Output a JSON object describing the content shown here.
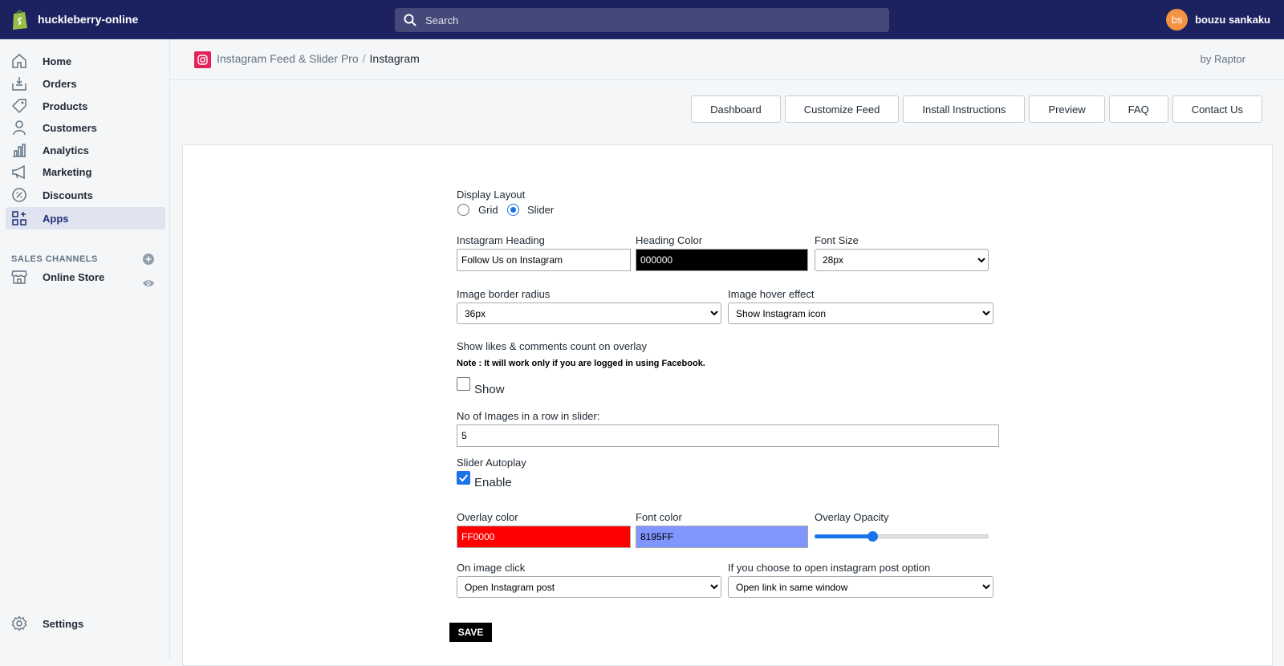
{
  "topbar": {
    "store_name": "huckleberry-online",
    "search_placeholder": "Search",
    "user_initials": "bs",
    "user_name": "bouzu sankaku"
  },
  "sidebar": {
    "items": [
      {
        "label": "Home",
        "icon": "home-icon"
      },
      {
        "label": "Orders",
        "icon": "orders-icon"
      },
      {
        "label": "Products",
        "icon": "tag-icon"
      },
      {
        "label": "Customers",
        "icon": "person-icon"
      },
      {
        "label": "Analytics",
        "icon": "bar-chart-icon"
      },
      {
        "label": "Marketing",
        "icon": "megaphone-icon"
      },
      {
        "label": "Discounts",
        "icon": "discount-icon"
      },
      {
        "label": "Apps",
        "icon": "apps-icon"
      }
    ],
    "sales_channels_title": "SALES CHANNELS",
    "online_store": "Online Store",
    "settings": "Settings"
  },
  "header": {
    "app_name": "Instagram Feed & Slider Pro",
    "separator": "/",
    "current": "Instagram",
    "byline": "by Raptor"
  },
  "tabs": [
    "Dashboard",
    "Customize Feed",
    "Install Instructions",
    "Preview",
    "FAQ",
    "Contact Us"
  ],
  "form": {
    "display_layout_label": "Display Layout",
    "layout_grid": "Grid",
    "layout_slider": "Slider",
    "layout_selected": "Slider",
    "heading_label": "Instagram Heading",
    "heading_value": "Follow Us on Instagram",
    "heading_color_label": "Heading Color",
    "heading_color_value": "000000",
    "font_size_label": "Font Size",
    "font_size_value": "28px",
    "border_radius_label": "Image border radius",
    "border_radius_value": "36px",
    "hover_effect_label": "Image hover effect",
    "hover_effect_value": "Show Instagram icon",
    "likes_label": "Show likes & comments count on overlay",
    "likes_note": "Note : It will work only if you are logged in using Facebook.",
    "likes_checkbox_label": "Show",
    "likes_checked": false,
    "images_row_label": "No of Images in a row in slider:",
    "images_row_value": "5",
    "autoplay_label": "Slider Autoplay",
    "autoplay_checkbox_label": "Enable",
    "autoplay_checked": true,
    "overlay_color_label": "Overlay color",
    "overlay_color_value": "FF0000",
    "font_color_label": "Font color",
    "font_color_value": "8195FF",
    "overlay_opacity_label": "Overlay Opacity",
    "overlay_opacity_fraction": 0.33,
    "image_click_label": "On image click",
    "image_click_value": "Open Instagram post",
    "open_option_label": "If you choose to open instagram post option",
    "open_option_value": "Open link in same window",
    "save_label": "SAVE"
  },
  "colors": {
    "topbar": "#1c2260",
    "heading_color_swatch": "#000000",
    "overlay_color_swatch": "#FF0000",
    "font_color_swatch": "#8195FF",
    "accent": "#1a73e8"
  }
}
